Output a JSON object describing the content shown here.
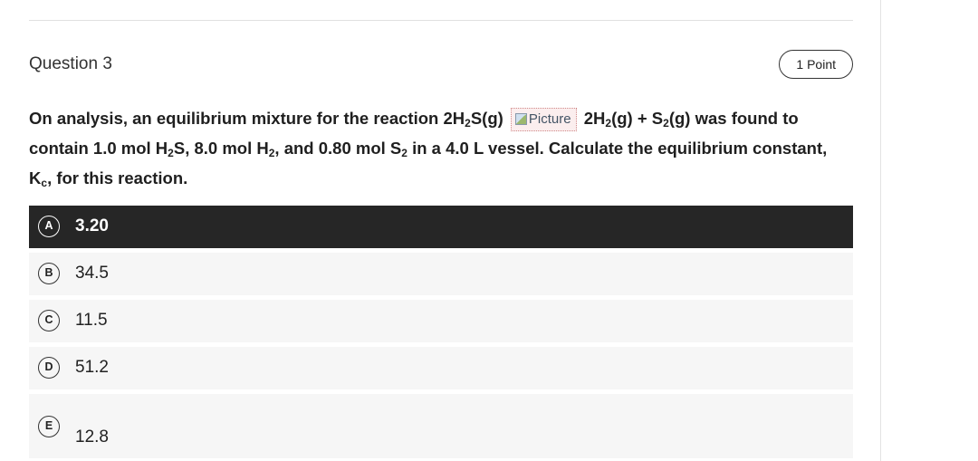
{
  "question": {
    "number_label": "Question 3",
    "points_label": "1 Point",
    "text_parts": {
      "p1": "On analysis, an equilibrium mixture for the reaction 2H",
      "s1": "2",
      "p2": "S(g) ",
      "picture_alt": "Picture",
      "p3": " 2H",
      "s2": "2",
      "p4": "(g) + S",
      "s3": "2",
      "p5": "(g) was found to contain 1.0 mol H",
      "s4": "2",
      "p6": "S, 8.0 mol H",
      "s5": "2",
      "p7": ", and 0.80 mol S",
      "s6": "2",
      "p8": " in a 4.0 L vessel. Calculate the equilibrium constant, K",
      "s7": "c",
      "p9": ", for this reaction."
    }
  },
  "options": [
    {
      "letter": "A",
      "text": "3.20",
      "selected": true
    },
    {
      "letter": "B",
      "text": "34.5",
      "selected": false
    },
    {
      "letter": "C",
      "text": "11.5",
      "selected": false
    },
    {
      "letter": "D",
      "text": "51.2",
      "selected": false
    },
    {
      "letter": "E",
      "text": "12.8",
      "selected": false
    }
  ],
  "colors": {
    "selected_bg": "#262626",
    "option_bg": "#f6f6f6"
  },
  "icons": {
    "broken_image": "broken-image-icon"
  }
}
